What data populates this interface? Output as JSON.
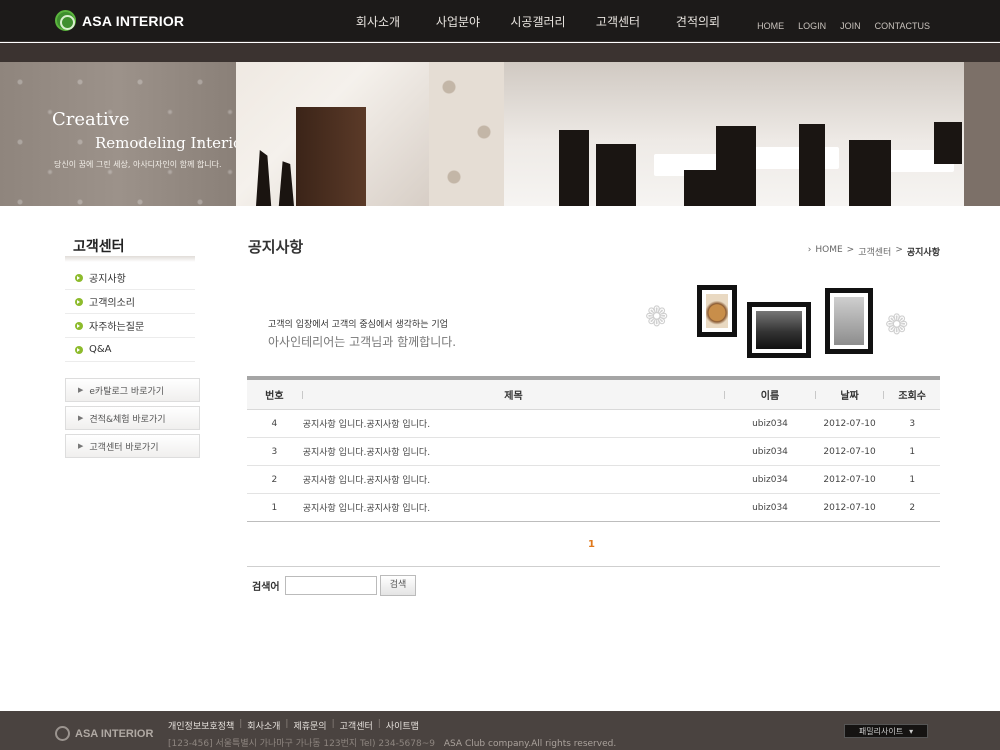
{
  "header": {
    "logo_text": "ASA INTERIOR",
    "gnb": [
      "회사소개",
      "사업분야",
      "시공갤러리",
      "고객센터",
      "견적의뢰"
    ],
    "topnav": [
      "HOME",
      "LOGIN",
      "JOIN",
      "CONTACTUS"
    ]
  },
  "hero": {
    "title": "Creative",
    "subtitle": "Remodeling Interior",
    "text": "당신이 꿈에 그린 세상, 아사디자인이 함께 합니다."
  },
  "sidebar": {
    "title": "고객센터",
    "items": [
      "공지사항",
      "고객의소리",
      "자주하는질문",
      "Q&A"
    ],
    "quick_links": [
      "e카탈로그 바로가기",
      "견적&체험 바로가기",
      "고객센터 바로가기"
    ]
  },
  "main": {
    "page_title": "공지사항",
    "breadcrumb": [
      "HOME",
      ">",
      "고객센터",
      ">",
      "공지사항"
    ],
    "intro_line1": "고객의 입장에서 고객의 중심에서 생각하는 기업",
    "intro_line2": "아사인테리어는 고객님과 함께합니다."
  },
  "board": {
    "headers": [
      "번호",
      "제목",
      "이름",
      "날짜",
      "조회수"
    ],
    "rows": [
      {
        "no": "4",
        "title": "공지사항 입니다.공지사항 입니다.",
        "name": "ubiz034",
        "date": "2012-07-10",
        "views": "3"
      },
      {
        "no": "3",
        "title": "공지사항 입니다.공지사항 입니다.",
        "name": "ubiz034",
        "date": "2012-07-10",
        "views": "1"
      },
      {
        "no": "2",
        "title": "공지사항 입니다.공지사항 입니다.",
        "name": "ubiz034",
        "date": "2012-07-10",
        "views": "1"
      },
      {
        "no": "1",
        "title": "공지사항 입니다.공지사항 입니다.",
        "name": "ubiz034",
        "date": "2012-07-10",
        "views": "2"
      }
    ],
    "page": "1",
    "search_label": "검색어",
    "search_value": "",
    "search_button": "검색"
  },
  "footer": {
    "logo_text": "ASA INTERIOR",
    "links": [
      "개인정보보호정책",
      "회사소개",
      "제휴문의",
      "고객센터",
      "사이트맵"
    ],
    "address": "[123-456] 서울특별시 가나마구 가나동 123번지 Tel) 234-5678~9",
    "copyright": "ASA Club company.All rights reserved.",
    "family_site": "패밀리사이트"
  },
  "colors": {
    "header_bg": "#1c1a19",
    "accent_green": "#8dbb2c",
    "pager_orange": "#e0781a",
    "footer_bg": "#4a4340"
  }
}
